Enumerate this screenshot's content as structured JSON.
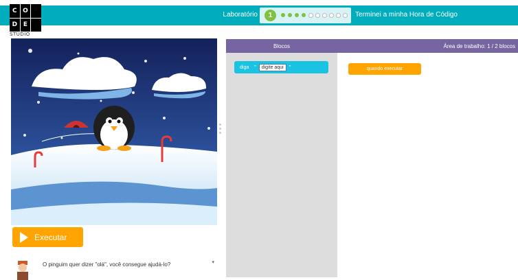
{
  "logo": {
    "letters": [
      "C",
      "O",
      "",
      "D",
      "E",
      ""
    ],
    "sub": "STUDIO"
  },
  "header": {
    "lab_label": "Laboratório",
    "level_number": "1",
    "progress_total": 11,
    "progress_done": 4,
    "finish_label": "Terminei a minha Hora de Código"
  },
  "colors": {
    "teal": "#00adbc",
    "purple": "#7665a0",
    "orange": "#ffa400",
    "cyan_block": "#19c3e1",
    "green": "#7fc241"
  },
  "stage": {
    "run_label": "Executar"
  },
  "instructions": {
    "text": "O pinguim quer dizer \"olá\", você consegue ajudá-lo?"
  },
  "workspace": {
    "toolbox_title": "Blocos",
    "workspace_title": "Área de trabalho: 1 / 2 blocos",
    "say_block": {
      "label": "diga",
      "q1": "\"",
      "value": "digite aqui",
      "q2": "\""
    },
    "when_run_block": {
      "label": "quando executar"
    }
  }
}
